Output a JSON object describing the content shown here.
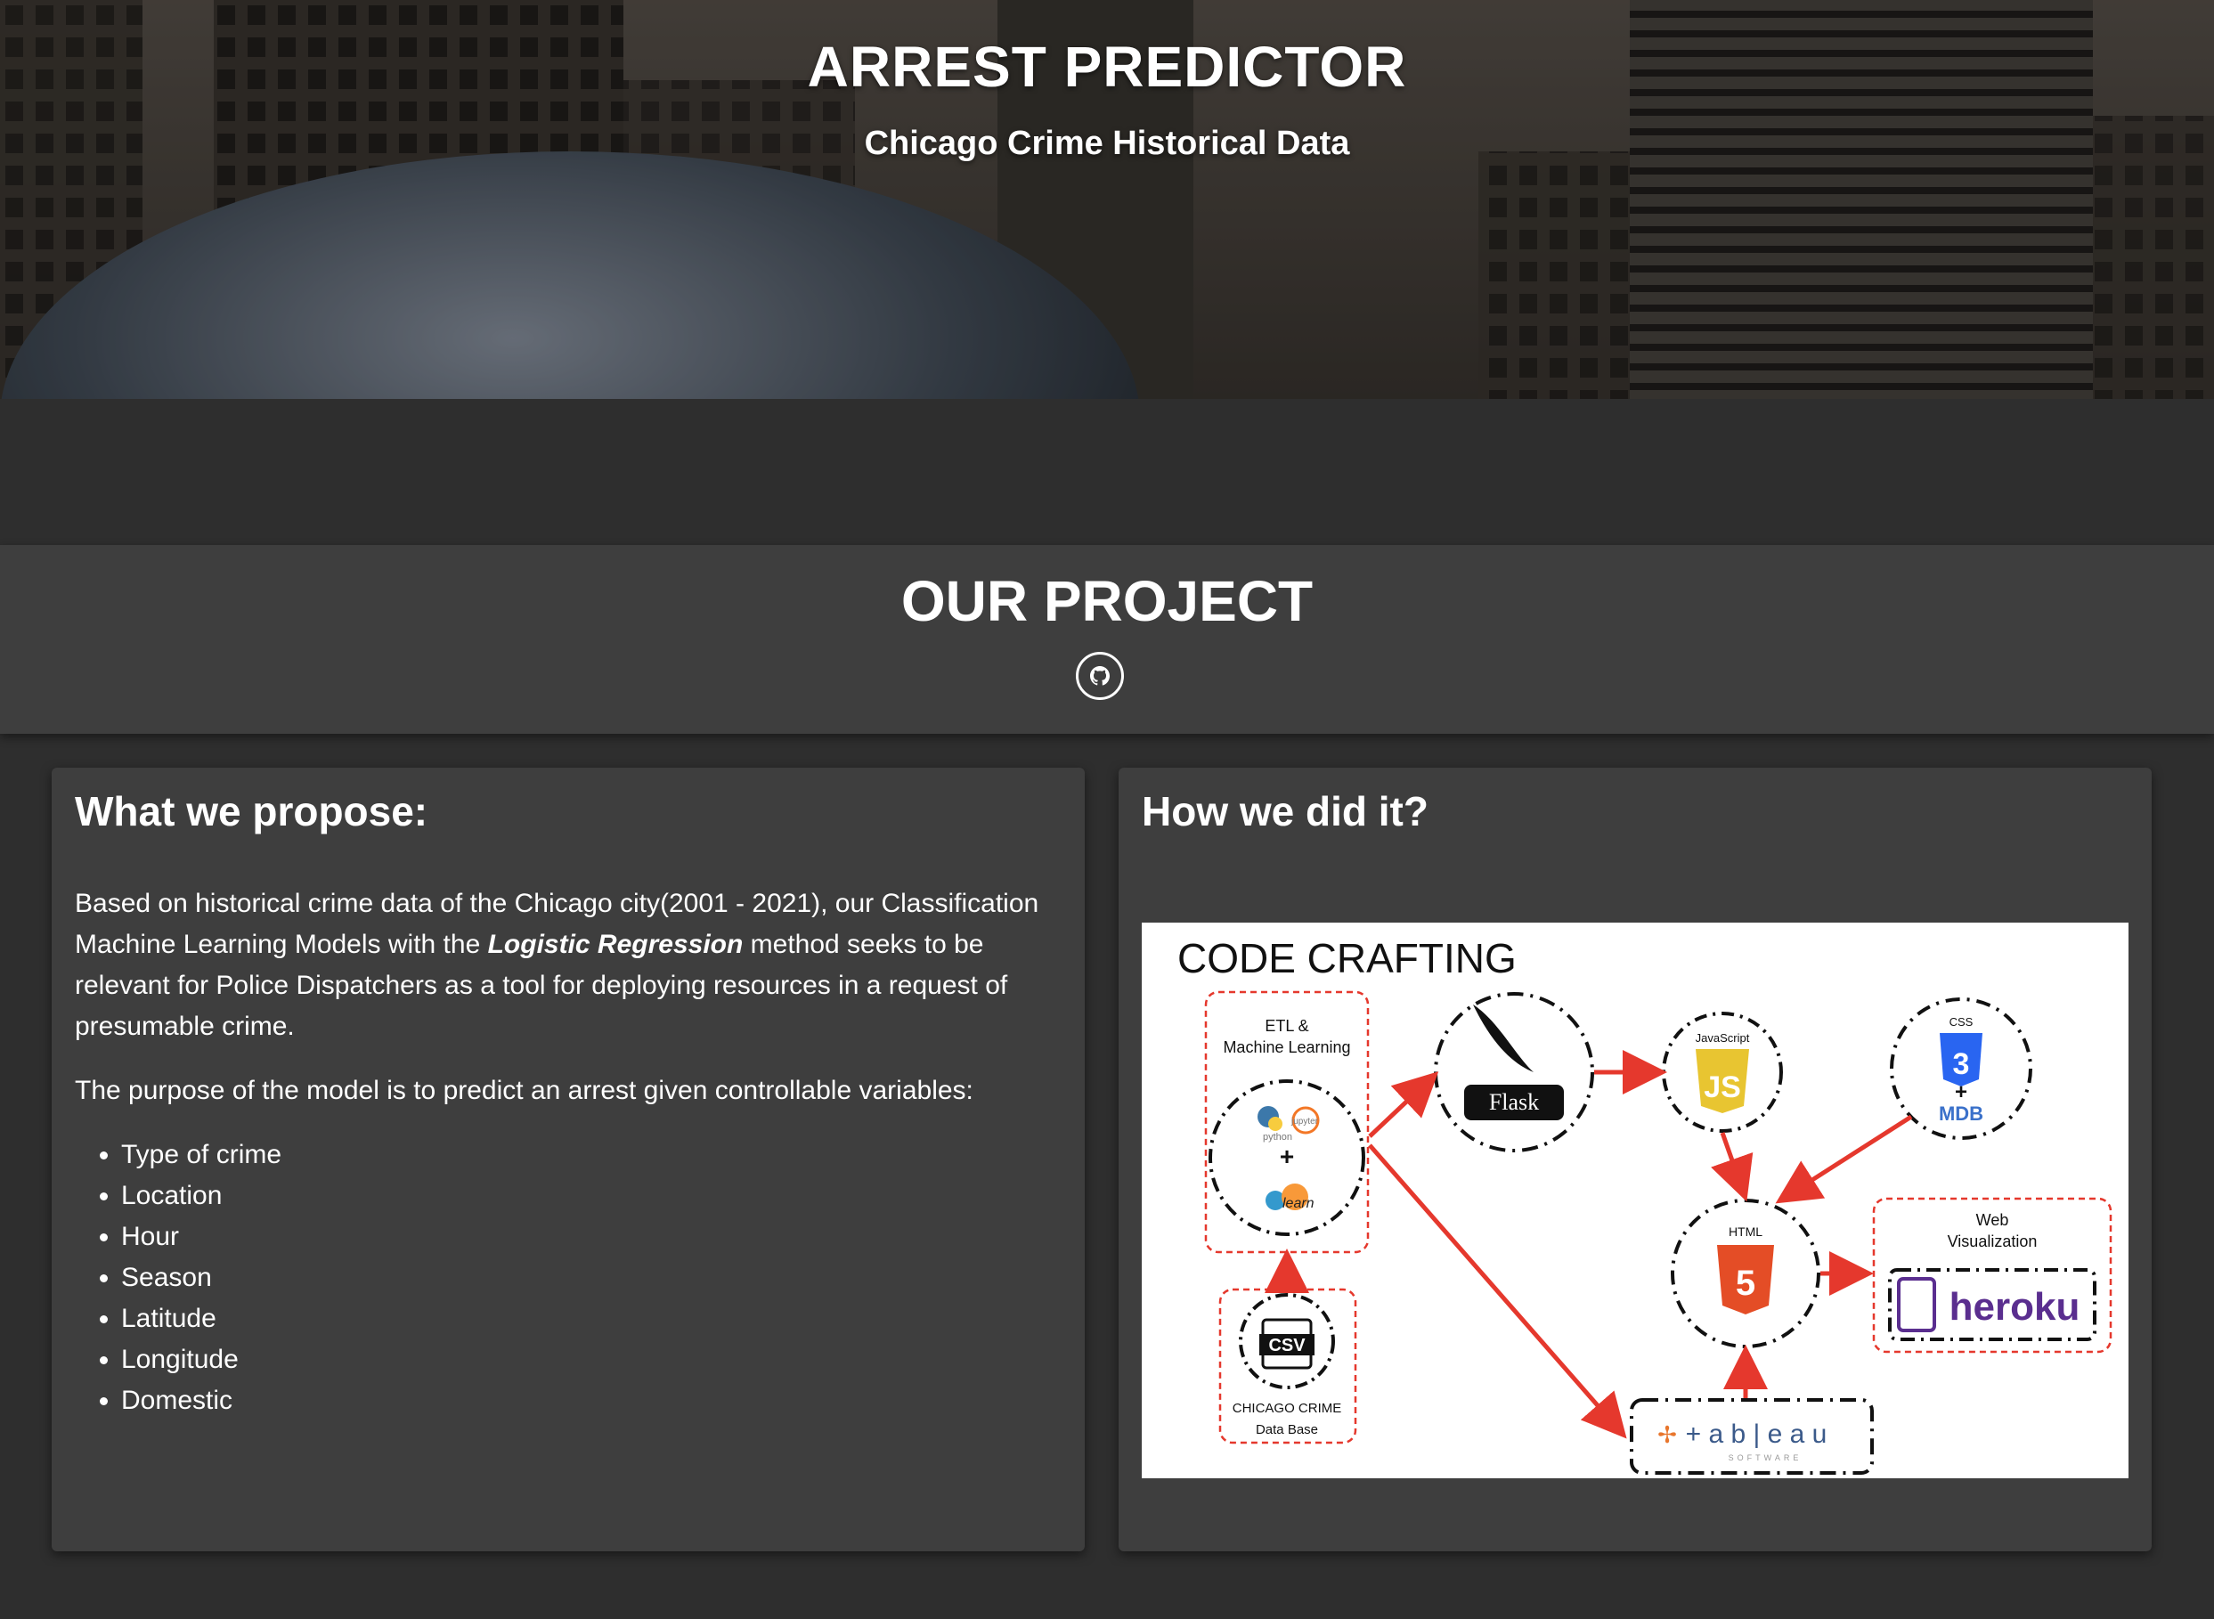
{
  "hero": {
    "title": "ARREST PREDICTOR",
    "subtitle": "Chicago Crime Historical Data"
  },
  "project": {
    "title": "OUR PROJECT",
    "github_icon": "github-icon"
  },
  "propose": {
    "heading": "What we propose:",
    "para1_before": "Based on historical crime data of the Chicago city(2001 - 2021), our Classification Machine Learning Models with the ",
    "para1_emphasis": "Logistic Regression",
    "para1_after": " method seeks to be relevant for Police Dispatchers as a tool for deploying resources in a request of presumable crime.",
    "para2": "The purpose of the model is to predict an arrest given controllable variables:",
    "variables": [
      "Type of crime",
      "Location",
      "Hour",
      "Season",
      "Latitude",
      "Longitude",
      "Domestic"
    ]
  },
  "how": {
    "heading": "How we did it?",
    "diagram": {
      "title": "CODE CRAFTING",
      "etl_label_1": "ETL &",
      "etl_label_2": "Machine Learning",
      "python_label": "python",
      "jupyter_label": "jupyter",
      "learn_label": "learn",
      "csv_label": "CSV",
      "db_label_1": "CHICAGO CRIME",
      "db_label_2": "Data Base",
      "flask_label": "Flask",
      "js_label": "JavaScript",
      "js_logo": "JS",
      "css_label": "CSS",
      "css_logo": "3",
      "mdb_label": "MDB",
      "html_label": "HTML",
      "html_logo": "5",
      "web_label_1": "Web",
      "web_label_2": "Visualization",
      "heroku_label": "heroku",
      "tableau_label": "+ a b | e a u",
      "tableau_sub": "SOFTWARE",
      "plus": "+"
    }
  },
  "colors": {
    "page_bg": "#2e2e2e",
    "panel_bg": "#3e3e3e",
    "arrow_red": "#e5382d",
    "heroku_purple": "#5a2e8f",
    "html_orange": "#e44d26",
    "css_blue": "#2965f1",
    "js_yellow": "#e8c531"
  }
}
